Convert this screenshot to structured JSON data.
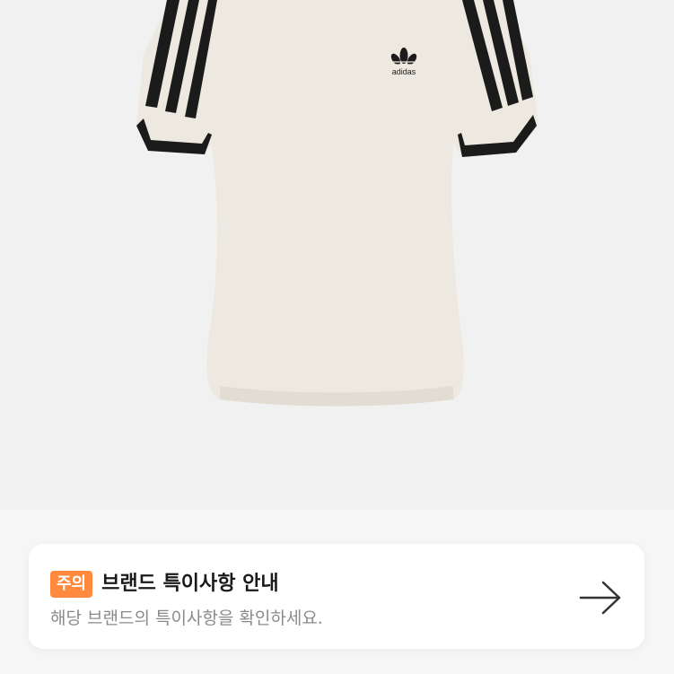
{
  "product": {
    "image_alt": "adidas white t-shirt with black three stripes",
    "logo_text": "adidas",
    "colors": {
      "shirt": "#ede9e0",
      "stripes": "#1b1b1b",
      "background": "#f1f1f1"
    }
  },
  "notice": {
    "badge": "주의",
    "title": "브랜드 특이사항 안내",
    "description": "해당 브랜드의 특이사항을 확인하세요.",
    "badge_color": "#ff8a3d",
    "arrow_icon": "arrow-right-icon"
  }
}
